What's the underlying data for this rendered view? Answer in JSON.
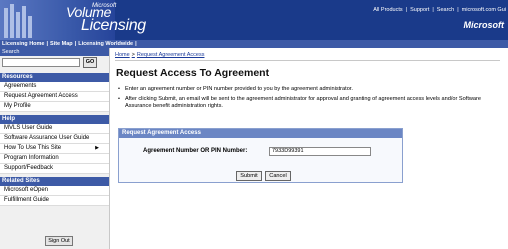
{
  "header": {
    "logo_microsoft": "Microsoft",
    "logo_volume": "Volume",
    "logo_licensing": "Licensing",
    "links": [
      "All Products",
      "Support",
      "Search",
      "microsoft.com Gui"
    ],
    "brand": "Microsoft"
  },
  "navbar": {
    "items": [
      "Licensing Home",
      "Site Map",
      "Licensing Worldwide"
    ]
  },
  "sidebar": {
    "search_label": "Search",
    "go_label": "GO",
    "sections": [
      {
        "title": "Resources",
        "items": [
          "Agreements",
          "Request Agreement Access",
          "My Profile"
        ]
      },
      {
        "title": "Help",
        "items": [
          "MVLS User Guide",
          "Software Assurance User Guide",
          "How To Use This Site",
          "Program Information",
          "Support/Feedback"
        ]
      },
      {
        "title": "Related Sites",
        "items": [
          "Microsoft eOpen",
          "Fulfillment Guide"
        ]
      }
    ],
    "signout_label": "Sign Out"
  },
  "main": {
    "breadcrumb": [
      "Home",
      "Request Agreement Access"
    ],
    "title": "Request Access To Agreement",
    "bullets": [
      "Enter an agreement number or PIN number provided to you by the agreement administrator.",
      "After clicking Submit, an email will be sent to the agreement administrator for approval and granting of agreement access levels and/or Software Assurance benefit administration rights."
    ],
    "form": {
      "heading": "Request Agreement Access",
      "field_label": "Agreement Number OR PIN Number:",
      "field_value": "7933D99391",
      "submit_label": "Submit",
      "cancel_label": "Cancel"
    }
  }
}
